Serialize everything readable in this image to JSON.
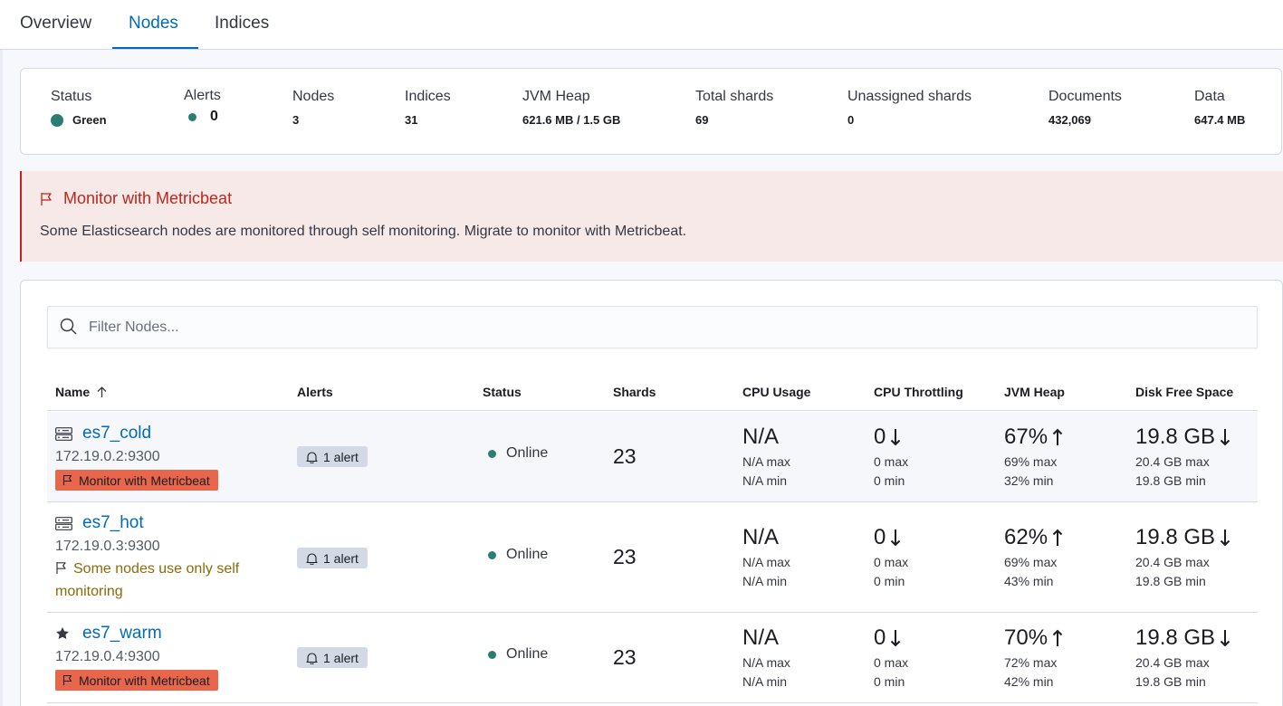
{
  "tabs": [
    {
      "label": "Overview"
    },
    {
      "label": "Nodes"
    },
    {
      "label": "Indices"
    }
  ],
  "summary": {
    "status": {
      "label": "Status",
      "value": "Green",
      "color": "#2a7e71"
    },
    "alerts": {
      "label": "Alerts",
      "value": "0"
    },
    "nodes": {
      "label": "Nodes",
      "value": "3"
    },
    "indices": {
      "label": "Indices",
      "value": "31"
    },
    "jvm_heap": {
      "label": "JVM Heap",
      "value": "621.6 MB / 1.5 GB"
    },
    "total_shards": {
      "label": "Total shards",
      "value": "69"
    },
    "unassigned_shards": {
      "label": "Unassigned shards",
      "value": "0"
    },
    "documents": {
      "label": "Documents",
      "value": "432,069"
    },
    "data": {
      "label": "Data",
      "value": "647.4 MB"
    }
  },
  "callout": {
    "icon": "flag-icon",
    "title": "Monitor with Metricbeat",
    "text": "Some Elasticsearch nodes are monitored through self monitoring. Migrate to monitor with Metricbeat."
  },
  "search": {
    "placeholder": "Filter Nodes..."
  },
  "table": {
    "headers": {
      "name": "Name",
      "alerts": "Alerts",
      "status": "Status",
      "shards": "Shards",
      "cpu_usage": "CPU Usage",
      "cpu_throttling": "CPU Throttling",
      "jvm_heap": "JVM Heap",
      "disk_free": "Disk Free Space"
    },
    "rows": [
      {
        "name": "es7_cold",
        "type_icon": "server-icon",
        "address": "172.19.0.2:9300",
        "badge": "Monitor with Metricbeat",
        "alerts": "1 alert",
        "status": "Online",
        "shards": "23",
        "cpu": {
          "value": "N/A",
          "max": "N/A max",
          "min": "N/A min"
        },
        "throttle": {
          "value": "0",
          "trend": "down",
          "max": "0 max",
          "min": "0 min"
        },
        "jvm": {
          "value": "67%",
          "trend": "up",
          "max": "69% max",
          "min": "32% min"
        },
        "disk": {
          "value": "19.8 GB",
          "trend": "down",
          "max": "20.4 GB max",
          "min": "19.8 GB min"
        }
      },
      {
        "name": "es7_hot",
        "type_icon": "server-icon",
        "address": "172.19.0.3:9300",
        "warning": "Some nodes use only self monitoring",
        "alerts": "1 alert",
        "status": "Online",
        "shards": "23",
        "cpu": {
          "value": "N/A",
          "max": "N/A max",
          "min": "N/A min"
        },
        "throttle": {
          "value": "0",
          "trend": "down",
          "max": "0 max",
          "min": "0 min"
        },
        "jvm": {
          "value": "62%",
          "trend": "up",
          "max": "69% max",
          "min": "43% min"
        },
        "disk": {
          "value": "19.8 GB",
          "trend": "down",
          "max": "20.4 GB max",
          "min": "19.8 GB min"
        }
      },
      {
        "name": "es7_warm",
        "type_icon": "star-icon",
        "address": "172.19.0.4:9300",
        "badge": "Monitor with Metricbeat",
        "alerts": "1 alert",
        "status": "Online",
        "shards": "23",
        "cpu": {
          "value": "N/A",
          "max": "N/A max",
          "min": "N/A min"
        },
        "throttle": {
          "value": "0",
          "trend": "down",
          "max": "0 max",
          "min": "0 min"
        },
        "jvm": {
          "value": "70%",
          "trend": "up",
          "max": "72% max",
          "min": "42% min"
        },
        "disk": {
          "value": "19.8 GB",
          "trend": "down",
          "max": "20.4 GB max",
          "min": "19.8 GB min"
        }
      }
    ]
  },
  "colors": {
    "accent": "#006bb8",
    "danger": "#bd271e",
    "success": "#2a7e71",
    "badge_danger": "#e7664c",
    "warning_text": "#8a6a0a"
  }
}
